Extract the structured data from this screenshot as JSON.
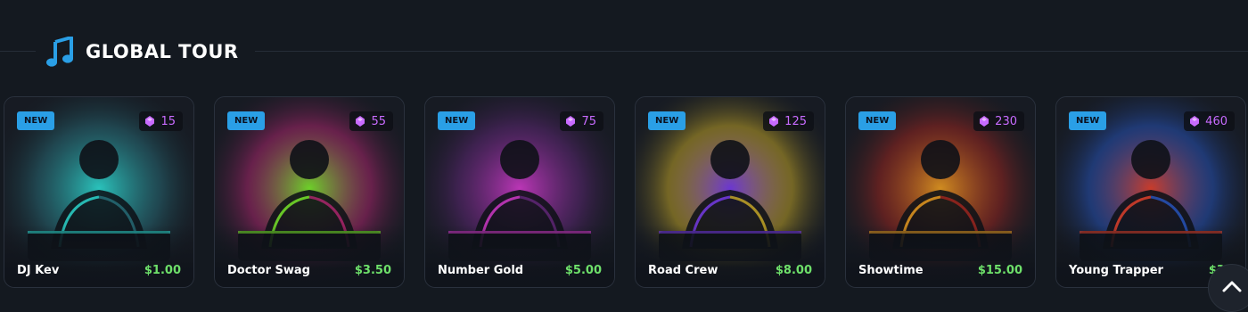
{
  "section": {
    "title": "GLOBAL TOUR",
    "icon": "music-note-icon",
    "accent": "#2a9fe6"
  },
  "cards": [
    {
      "name": "DJ Kev",
      "price": "$1.00",
      "gems": "15",
      "badge": "NEW",
      "theme": "#2de0d6",
      "theme2": "#2b7a86"
    },
    {
      "name": "Doctor Swag",
      "price": "$3.50",
      "gems": "55",
      "badge": "NEW",
      "theme": "#7cf02a",
      "theme2": "#c9287c"
    },
    {
      "name": "Number Gold",
      "price": "$5.00",
      "gems": "75",
      "badge": "NEW",
      "theme": "#d83bd0",
      "theme2": "#6d2a86"
    },
    {
      "name": "Road Crew",
      "price": "$8.00",
      "gems": "125",
      "badge": "NEW",
      "theme": "#7b3cf0",
      "theme2": "#e6c228"
    },
    {
      "name": "Showtime",
      "price": "$15.00",
      "gems": "230",
      "badge": "NEW",
      "theme": "#f0a020",
      "theme2": "#b5281f"
    },
    {
      "name": "Young Trapper",
      "price": "$30",
      "gems": "460",
      "badge": "NEW",
      "theme": "#e8422c",
      "theme2": "#2a5fd8"
    }
  ],
  "colors": {
    "background": "#141920",
    "price": "#6ee06a",
    "gem": "#c86bff",
    "badge": "#2a9fe6"
  },
  "scroll_top": {
    "icon": "chevron-up-icon"
  }
}
